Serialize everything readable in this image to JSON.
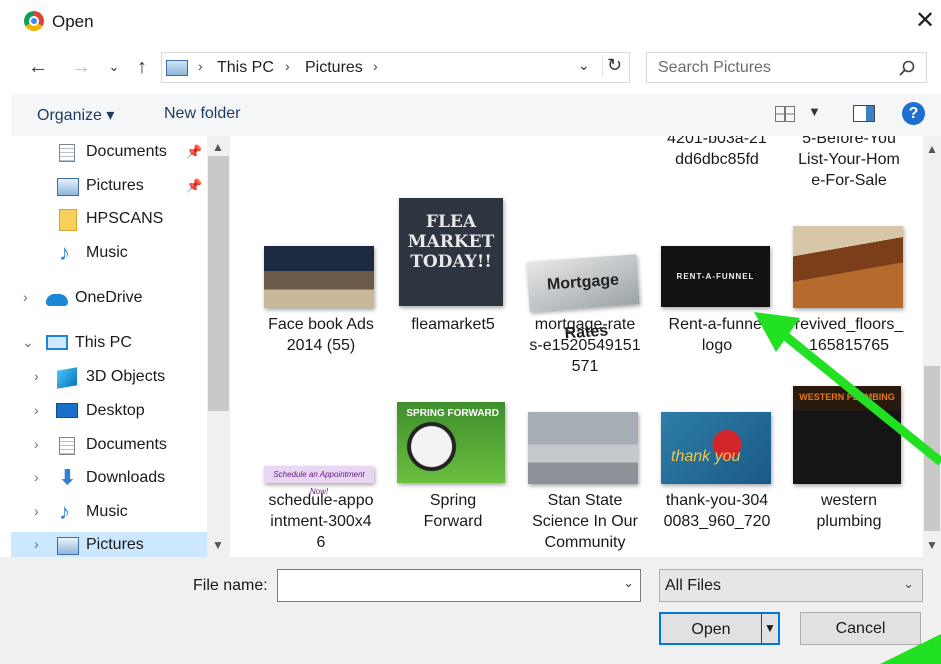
{
  "window": {
    "title": "Open",
    "close_glyph": "✕"
  },
  "address": {
    "segments": [
      "This PC",
      "Pictures"
    ],
    "search_placeholder": "Search Pictures"
  },
  "toolbar": {
    "organize": "Organize ▾",
    "new_folder": "New folder",
    "help": "?"
  },
  "nav": {
    "items": [
      {
        "label": "Documents",
        "icon": "documents-icon",
        "pinned": true
      },
      {
        "label": "Pictures",
        "icon": "pictures-icon",
        "pinned": true
      },
      {
        "label": "HPSCANS",
        "icon": "folder-icon"
      },
      {
        "label": "Music",
        "icon": "music-icon"
      },
      {
        "label": "OneDrive",
        "icon": "onedrive-icon"
      },
      {
        "label": "This PC",
        "icon": "this-pc-icon"
      },
      {
        "label": "3D Objects",
        "icon": "3d-objects-icon"
      },
      {
        "label": "Desktop",
        "icon": "desktop-icon"
      },
      {
        "label": "Documents",
        "icon": "documents-icon"
      },
      {
        "label": "Downloads",
        "icon": "downloads-icon"
      },
      {
        "label": "Music",
        "icon": "music-icon"
      },
      {
        "label": "Pictures",
        "icon": "pictures-icon",
        "selected": true
      }
    ]
  },
  "files": {
    "partial_top": [
      {
        "name": "4201-b03a-21\ndd6dbc85fd"
      },
      {
        "name": "5-Before-You\nList-Your-Hom\ne-For-Sale"
      }
    ],
    "row1": [
      {
        "name": "Face book Ads\n2014  (55)"
      },
      {
        "name": "fleamarket5",
        "thumb_text": "FLEA MARKET TODAY!!"
      },
      {
        "name": "mortgage-rate\ns-e1520549151\n571",
        "thumb_text": "Mortgage Rates"
      },
      {
        "name": "Rent-a-funnel\nlogo",
        "thumb_text": "RENT-A-FUNNEL"
      },
      {
        "name": "revived_floors_\n165815765"
      }
    ],
    "row2": [
      {
        "name": "schedule-appo\nintment-300x4\n6",
        "thumb_text": "Schedule an Appointment Now!"
      },
      {
        "name": "Spring\nForward",
        "thumb_text": "SPRING FORWARD"
      },
      {
        "name": "Stan State\nScience In Our\nCommunity"
      },
      {
        "name": "thank-you-304\n0083_960_720",
        "thumb_text": "thank you"
      },
      {
        "name": "western\nplumbing",
        "thumb_text": "WESTERN PLUMBING"
      }
    ]
  },
  "bottom": {
    "file_name_label": "File name:",
    "file_name_value": "",
    "file_type": "All Files",
    "open_label": "Open",
    "cancel_label": "Cancel"
  },
  "colors": {
    "accent": "#0078d7",
    "selection": "#cce8ff",
    "annotation": "#22e022"
  }
}
